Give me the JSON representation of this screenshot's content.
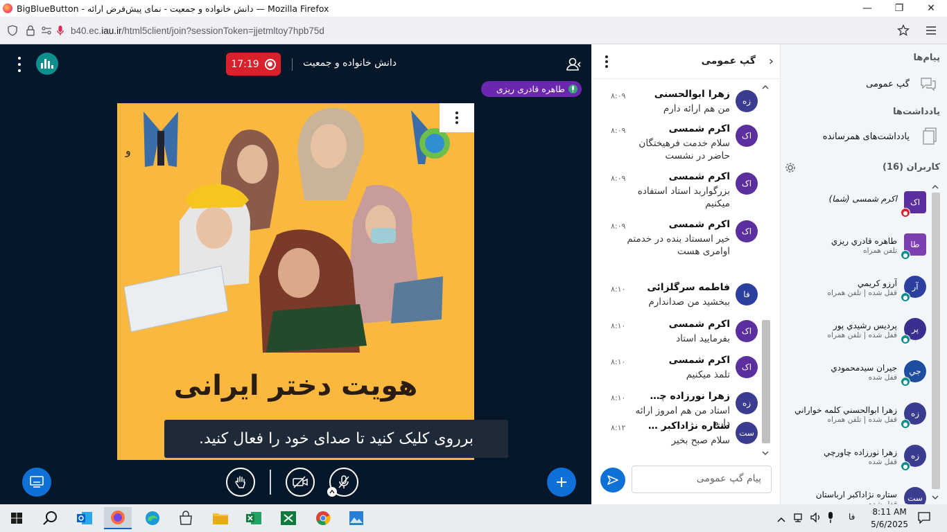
{
  "window": {
    "title": "BigBlueButton - دانش خانواده و جمعیت - نمای پیش‌فرض ارائه — Mozilla Firefox",
    "url_prefix": "b40.ec.",
    "url_domain": "iau.ir",
    "url_rest": "/html5client/join?sessionToken=jjetmltoy7hpb75d"
  },
  "header": {
    "record_time": "17:19",
    "meeting_title": "دانش خانواده و جمعیت"
  },
  "talking_indicator": "طاهره قادری ریزی",
  "presentation": {
    "headline": "هویت دختر ایرانی",
    "toast": "برروی  کلیک کنید تا صدای خود را فعال کنید."
  },
  "chat": {
    "title": "گپ عمومی",
    "input_placeholder": "پیام گپ عمومی",
    "messages": [
      {
        "initials": "زه",
        "color": "#3a3d8f",
        "name": "زهرا ابوالحسنی",
        "time": "۸:۰۹",
        "text": "من هم ارائه دارم"
      },
      {
        "initials": "اک",
        "color": "#5b2f9e",
        "name": "اکرم شمسی",
        "time": "۸:۰۹",
        "text": "سلام خدمت فرهیختگان حاضر در نشست"
      },
      {
        "initials": "اک",
        "color": "#5b2f9e",
        "name": "اکرم شمسی",
        "time": "۸:۰۹",
        "text": "بزرگواربد استاد استفاده میکنیم"
      },
      {
        "initials": "اک",
        "color": "#5b2f9e",
        "name": "اکرم شمسی",
        "time": "۸:۰۹",
        "text": "خیر اسستاد بنده در خدمتم اوامری هست"
      },
      {
        "initials": "فا",
        "color": "#2a3f9e",
        "name": "فاطمه سرگلزائی",
        "time": "۸:۱۰",
        "text": "ببخشید من صداندارم"
      },
      {
        "initials": "اک",
        "color": "#5b2f9e",
        "name": "اکرم شمسی",
        "time": "۸:۱۰",
        "text": "بفرمایید استاد"
      },
      {
        "initials": "اک",
        "color": "#5b2f9e",
        "name": "اکرم شمسی",
        "time": "۸:۱۰",
        "text": "تلمذ میکنیم"
      },
      {
        "initials": "زه",
        "color": "#3a3d8f",
        "name": "زهرا نورزاده چاورچی",
        "time": "۸:۱۰",
        "text": "استاد من هم امروز ارائه دارم"
      },
      {
        "initials": "ست",
        "color": "#3a3d8f",
        "name": "ستاره نژاداکبر اریاستان",
        "time": "۸:۱۲",
        "text": "سلام صبح بخیر"
      }
    ]
  },
  "sidebar": {
    "messages_title": "پیام‌ها",
    "public_chat": "گپ عمومی",
    "notes_title": "یادداشت‌ها",
    "shared_notes": "یادداشت‌های همرسانده",
    "users_title": "کاربران (16)",
    "users": [
      {
        "initials": "اک",
        "color": "#5b2f9e",
        "name": "اکرم شمسی (شما)",
        "status": "",
        "badge": "#d9212c",
        "square": true
      },
      {
        "initials": "طا",
        "color": "#7b3fb0",
        "name": "طاهره قادري ريزي",
        "status": "تلفن همراه",
        "badge": "#0f8e8e",
        "square": true
      },
      {
        "initials": "آر",
        "color": "#2a3f9e",
        "name": "آرزو کريمي",
        "status": "قفل شده | تلفن همراه",
        "badge": "#0f8e8e",
        "square": false
      },
      {
        "initials": "پر",
        "color": "#3a2f8e",
        "name": "پرديس رشيدي پور",
        "status": "قفل شده | تلفن همراه",
        "badge": "#0f8e8e",
        "square": false
      },
      {
        "initials": "جي",
        "color": "#1e4f9e",
        "name": "جيران سيدمحمودي",
        "status": "قفل شده",
        "badge": "#0f8e8e",
        "square": false
      },
      {
        "initials": "زه",
        "color": "#3a3d8f",
        "name": "زهرا ابوالحسني کلمه خواراني",
        "status": "قفل شده | تلفن همراه",
        "badge": "#0f8e8e",
        "square": false
      },
      {
        "initials": "زه",
        "color": "#3a3d8f",
        "name": "زهرا نورزاده چاورچي",
        "status": "قفل شده",
        "badge": "#0f8e8e",
        "square": false
      },
      {
        "initials": "ست",
        "color": "#3a3d8f",
        "name": "ستاره نژاداکبر ارباستان",
        "status": "قفل شده",
        "badge": "#0f8e8e",
        "square": false
      }
    ]
  },
  "taskbar": {
    "lang": "فا",
    "time": "8:11 AM",
    "date": "5/6/2025"
  }
}
